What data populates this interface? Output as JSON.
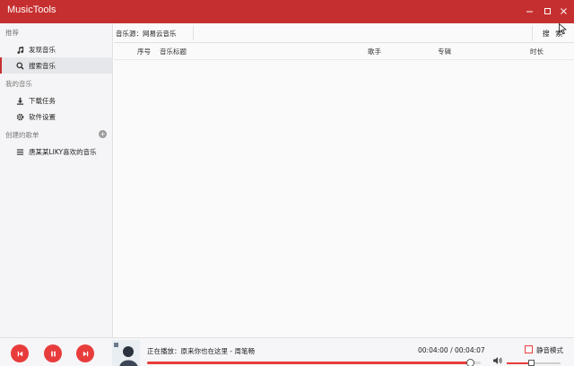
{
  "app": {
    "title": "MusicTools"
  },
  "window": {
    "minimize": "—",
    "maximize": "☐",
    "close": "✕"
  },
  "sidebar": {
    "sections": [
      {
        "title": "推荐"
      },
      {
        "title": "我的音乐"
      },
      {
        "title": "创建的歌单"
      }
    ],
    "items": [
      {
        "label": "发现音乐",
        "icon": "music-note-icon"
      },
      {
        "label": "搜索音乐",
        "icon": "search-icon",
        "active": true
      },
      {
        "label": "下载任务",
        "icon": "download-icon"
      },
      {
        "label": "软件设置",
        "icon": "gear-icon"
      },
      {
        "label": "唐某某LIKY喜欢的音乐",
        "icon": "list-icon"
      }
    ]
  },
  "main": {
    "source_label": "音乐源：网易云音乐",
    "search_button": "搜 索",
    "columns": {
      "index": "序号",
      "title": "音乐标题",
      "artist": "歌手",
      "album": "专辑",
      "duration": "时长"
    }
  },
  "player": {
    "now_playing": "正在播放：原来你也在这里 - 周笔畅",
    "time": "00:04:00 / 00:04:07",
    "progress": 0.97,
    "volume": 0.45,
    "mute_label": "静音模式",
    "accent": "#e83c3c"
  },
  "colors": {
    "titlebar": "#c62f2f",
    "accent": "#e83c3c",
    "sidebar_bg": "#f5f5f7"
  }
}
